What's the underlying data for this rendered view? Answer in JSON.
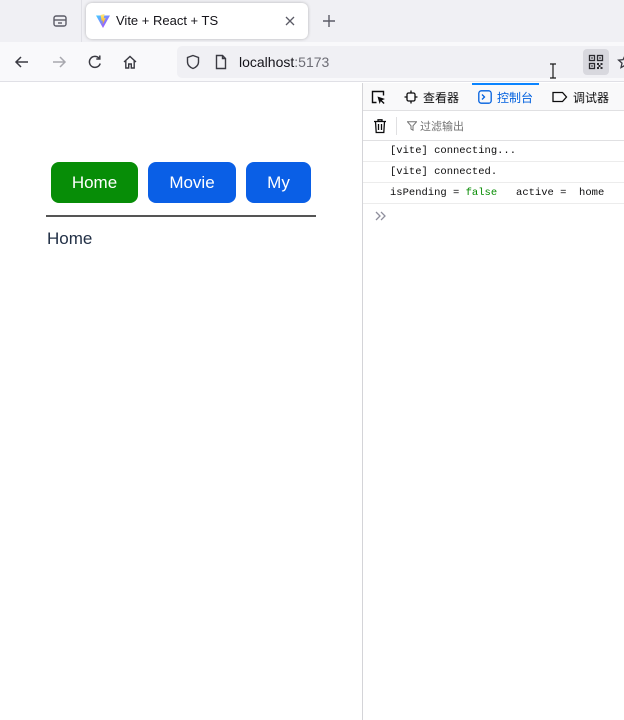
{
  "browser": {
    "tab": {
      "title": "Vite + React + TS"
    },
    "url": {
      "host": "localhost",
      "port": ":5173"
    }
  },
  "app": {
    "buttons": [
      {
        "label": "Home",
        "color": "#078d07"
      },
      {
        "label": "Movie",
        "color": "#0a5fe6"
      },
      {
        "label": "My",
        "color": "#0a5fe6"
      }
    ],
    "content": "Home"
  },
  "devtools": {
    "tabs": [
      {
        "label": "查看器",
        "icon": "inspector-icon"
      },
      {
        "label": "控制台",
        "icon": "console-icon",
        "active": true
      },
      {
        "label": "调试器",
        "icon": "debugger-icon"
      }
    ],
    "filter_placeholder": "过滤输出",
    "logs": [
      {
        "text": "[vite] connecting..."
      },
      {
        "text": "[vite] connected."
      },
      {
        "parts": [
          "isPending = ",
          "false",
          "   active =  home"
        ]
      }
    ]
  }
}
